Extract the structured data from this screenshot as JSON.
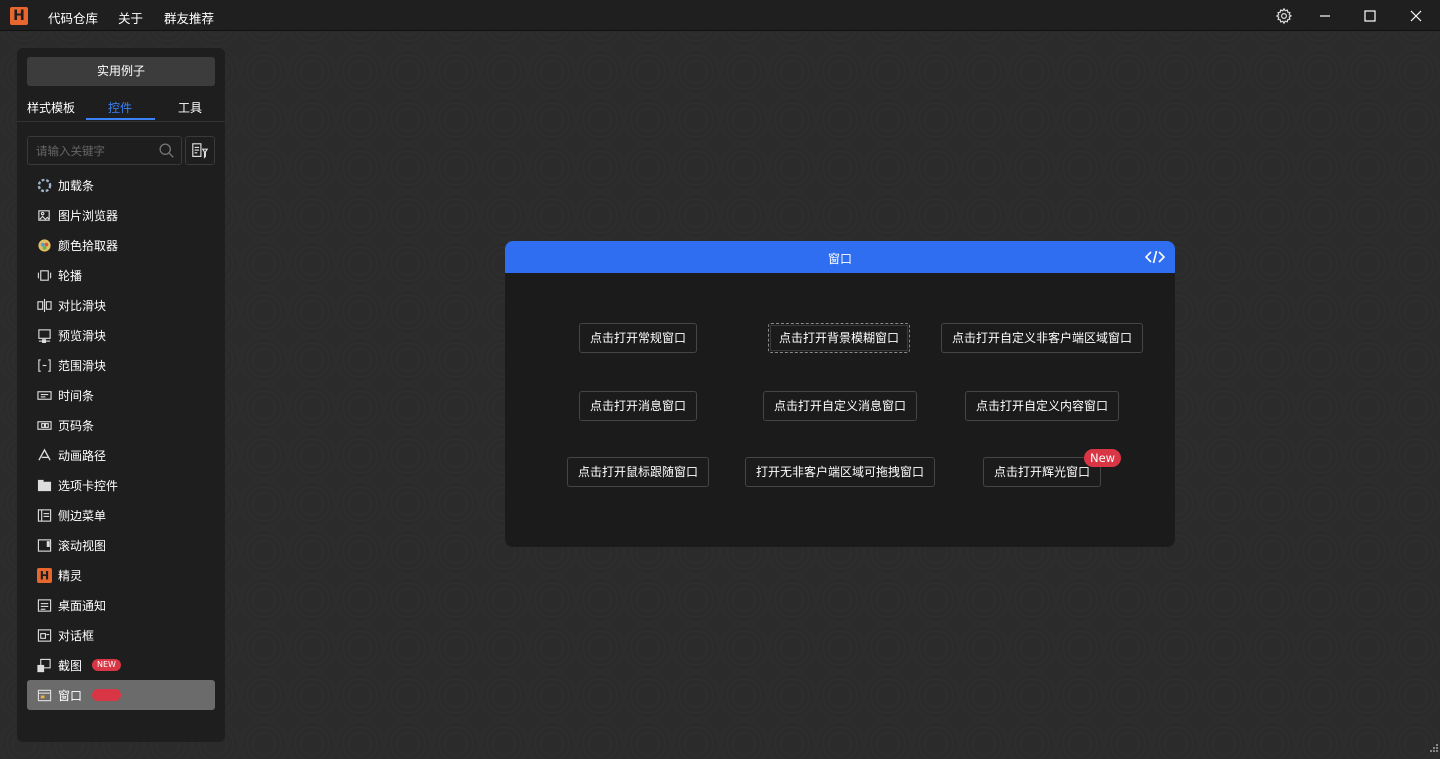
{
  "titlebar": {
    "logo_letter": "H",
    "menu": [
      "代码仓库",
      "关于",
      "群友推荐"
    ]
  },
  "sidebar": {
    "examples_button": "实用例子",
    "tabs": [
      "样式模板",
      "控件",
      "工具"
    ],
    "active_tab": "控件",
    "search_placeholder": "请输入关键字",
    "new_badge": "NEW",
    "items": [
      {
        "label": "加载条",
        "icon": "loading-icon"
      },
      {
        "label": "图片浏览器",
        "icon": "image-viewer-icon"
      },
      {
        "label": "颜色拾取器",
        "icon": "color-picker-icon"
      },
      {
        "label": "轮播",
        "icon": "carousel-icon"
      },
      {
        "label": "对比滑块",
        "icon": "compare-slider-icon"
      },
      {
        "label": "预览滑块",
        "icon": "preview-slider-icon"
      },
      {
        "label": "范围滑块",
        "icon": "range-slider-icon"
      },
      {
        "label": "时间条",
        "icon": "timeline-icon"
      },
      {
        "label": "页码条",
        "icon": "pagination-icon"
      },
      {
        "label": "动画路径",
        "icon": "animation-path-icon"
      },
      {
        "label": "选项卡控件",
        "icon": "tab-control-icon"
      },
      {
        "label": "侧边菜单",
        "icon": "side-menu-icon"
      },
      {
        "label": "滚动视图",
        "icon": "scroll-view-icon"
      },
      {
        "label": "精灵",
        "icon": "sprite-icon"
      },
      {
        "label": "桌面通知",
        "icon": "notification-icon"
      },
      {
        "label": "对话框",
        "icon": "dialog-icon"
      },
      {
        "label": "截图",
        "icon": "screenshot-icon",
        "badge": true
      },
      {
        "label": "窗口",
        "icon": "window-icon",
        "badge": true,
        "selected": true
      }
    ]
  },
  "card": {
    "title": "窗口",
    "buttons": [
      "点击打开常规窗口",
      "点击打开背景模糊窗口",
      "点击打开自定义非客户端区域窗口",
      "点击打开消息窗口",
      "点击打开自定义消息窗口",
      "点击打开自定义内容窗口",
      "点击打开鼠标跟随窗口",
      "打开无非客户端区域可拖拽窗口",
      "点击打开辉光窗口"
    ],
    "new_label": "New"
  },
  "colors": {
    "accent": "#3b82f6",
    "header": "#2f6ef0",
    "badge": "#d93645",
    "logo": "#e8672e"
  }
}
